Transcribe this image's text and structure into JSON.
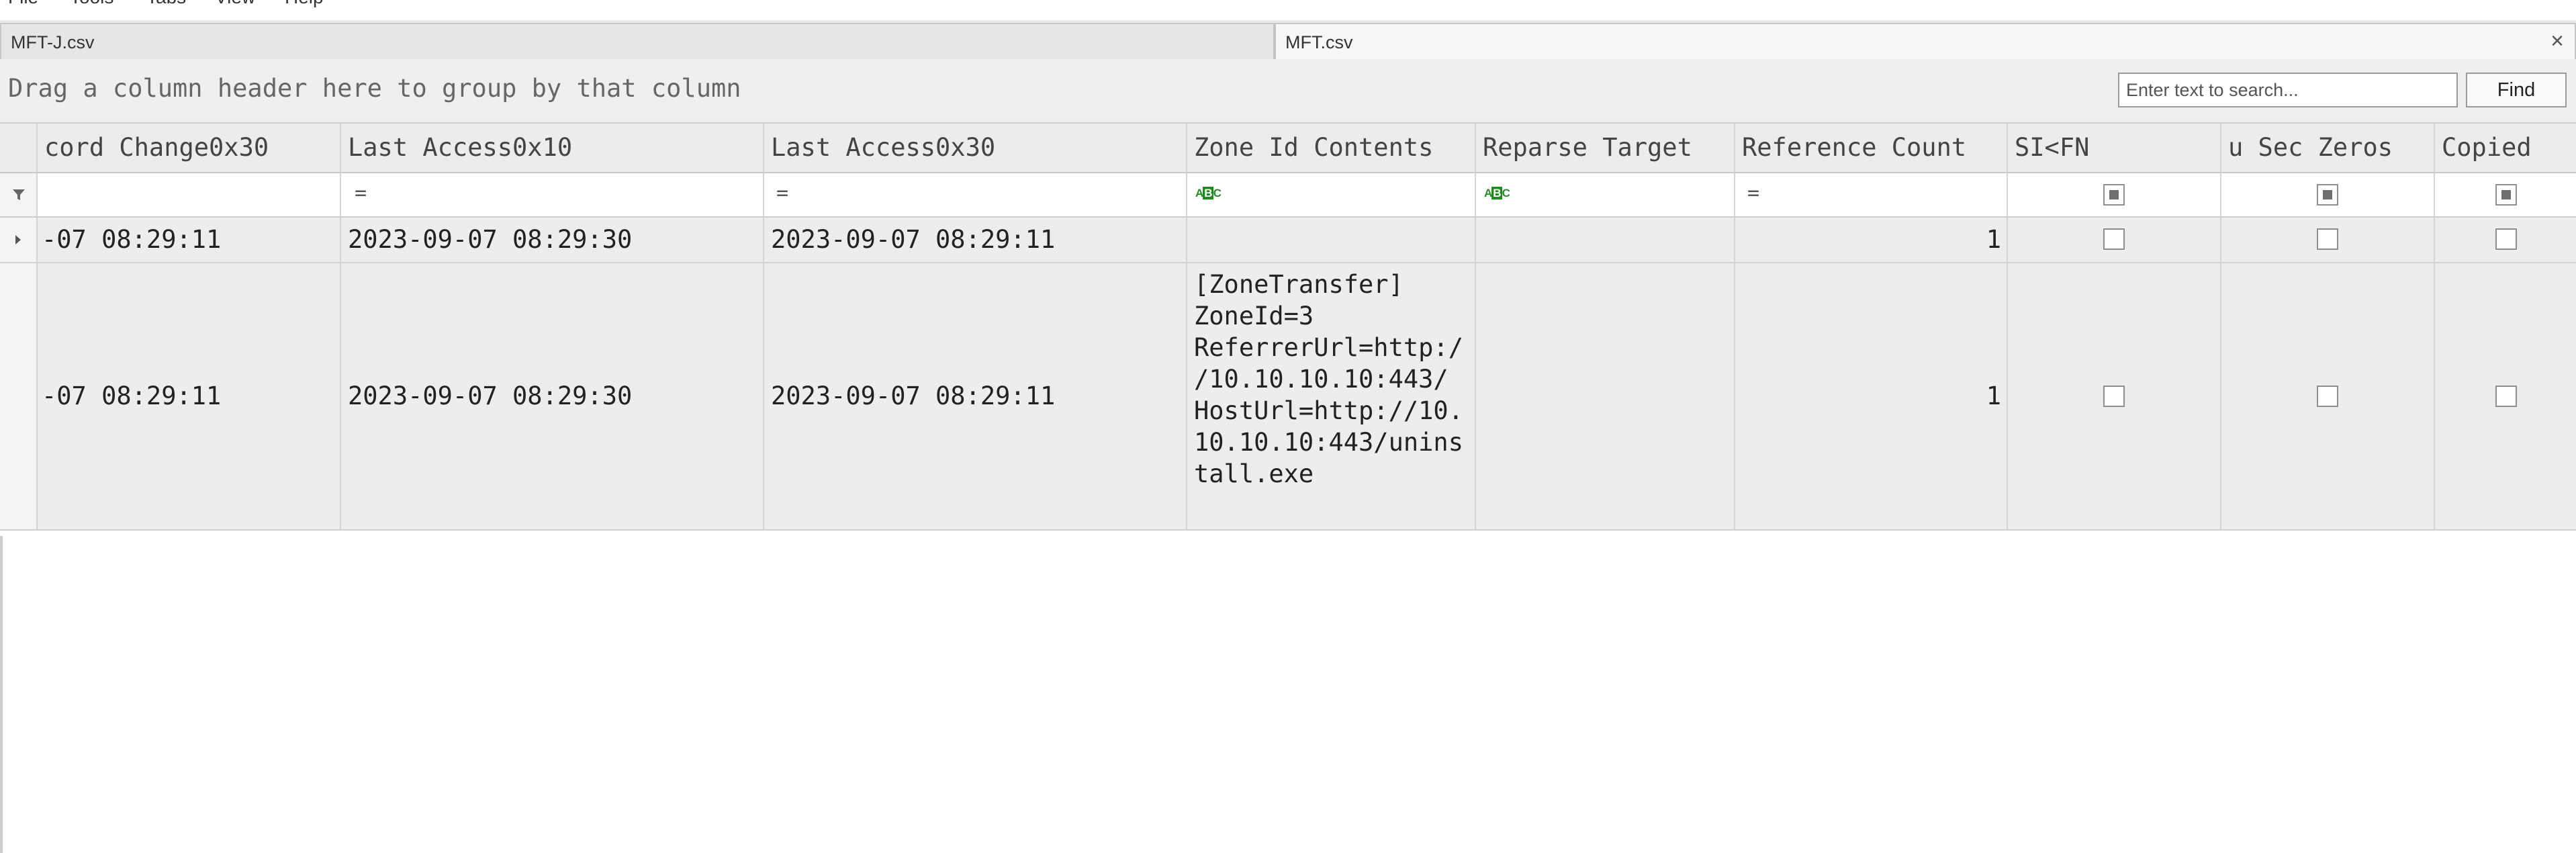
{
  "menu": [
    "File",
    "Tools",
    "Tabs",
    "View",
    "Help"
  ],
  "tabs": [
    {
      "label": "MFT-J.csv",
      "active": false
    },
    {
      "label": "MFT.csv",
      "active": true
    }
  ],
  "tab_close_icon": "×",
  "group_panel": {
    "hint": "Drag a column header here to group by that column"
  },
  "search": {
    "placeholder": "Enter text to search...",
    "value": "",
    "find_label": "Find"
  },
  "columns": [
    "cord Change0x30",
    "Last Access0x10",
    "Last Access0x30",
    "Zone Id Contents",
    "Reparse Target",
    "Reference Count",
    "SI<FN",
    "u Sec Zeros",
    "Copied"
  ],
  "filters": {
    "eq": "=",
    "abc": "ABC"
  },
  "rows": [
    {
      "record_change": "-07 08:29:11",
      "last_access_0x10": "2023-09-07 08:29:30",
      "last_access_0x30": "2023-09-07 08:29:11",
      "zone_id_contents": [],
      "reparse_target": "",
      "reference_count": "1",
      "si_lt_fn": false,
      "u_sec_zeros": false,
      "copied": false
    },
    {
      "record_change": "-07 08:29:11",
      "last_access_0x10": "2023-09-07 08:29:30",
      "last_access_0x30": "2023-09-07 08:29:11",
      "zone_id_contents": [
        "[ZoneTransfer]",
        "ZoneId=3",
        "ReferrerUrl=http:/",
        "/10.10.10.10:443/",
        "HostUrl=http://10.",
        "10.10.10:443/unins",
        "tall.exe"
      ],
      "reparse_target": "",
      "reference_count": "1",
      "si_lt_fn": false,
      "u_sec_zeros": false,
      "copied": false
    }
  ]
}
